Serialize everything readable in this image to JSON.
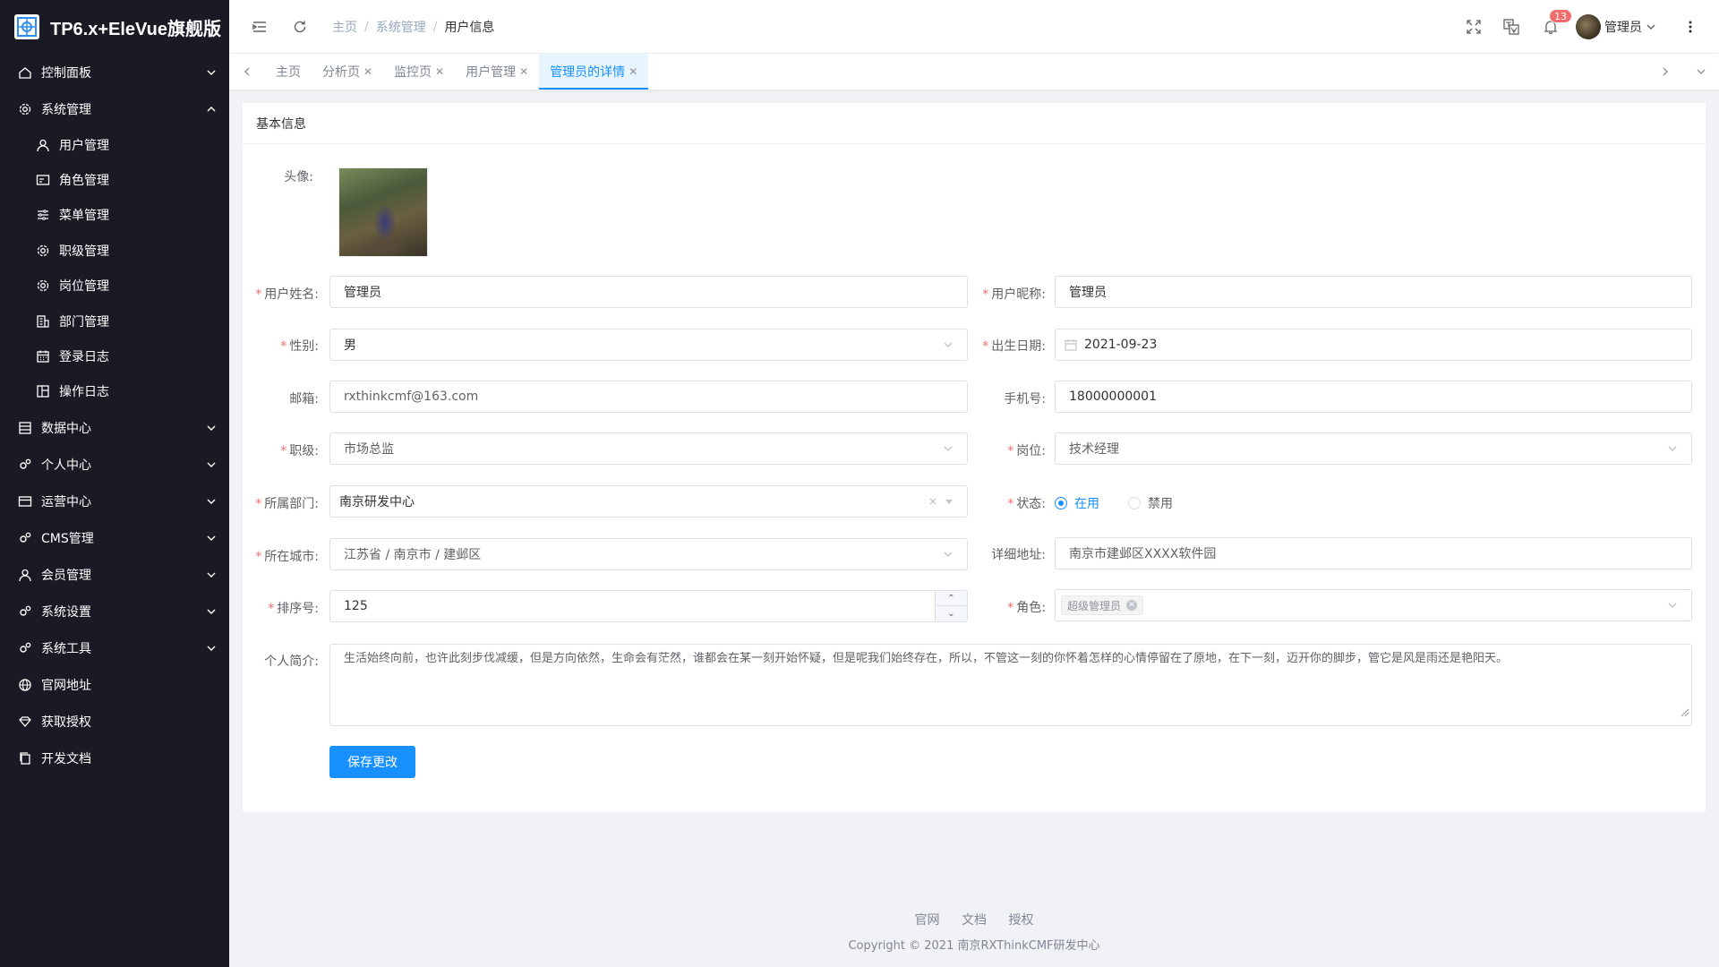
{
  "app": {
    "title": "TP6.x+EleVue旗舰版"
  },
  "sidebar": {
    "items": [
      {
        "label": "控制面板",
        "icon": "home-icon"
      },
      {
        "label": "系统管理",
        "icon": "gear-icon"
      },
      {
        "label": "数据中心",
        "icon": "database-icon"
      },
      {
        "label": "个人中心",
        "icon": "gears-icon"
      },
      {
        "label": "运营中心",
        "icon": "card-icon"
      },
      {
        "label": "CMS管理",
        "icon": "gears-icon"
      },
      {
        "label": "会员管理",
        "icon": "user-icon"
      },
      {
        "label": "系统设置",
        "icon": "gears-icon"
      },
      {
        "label": "系统工具",
        "icon": "gears-icon"
      },
      {
        "label": "官网地址",
        "icon": "globe-icon"
      },
      {
        "label": "获取授权",
        "icon": "diamond-icon"
      },
      {
        "label": "开发文档",
        "icon": "copy-icon"
      }
    ],
    "submenu": [
      {
        "label": "用户管理",
        "icon": "user-icon"
      },
      {
        "label": "角色管理",
        "icon": "idcard-icon"
      },
      {
        "label": "菜单管理",
        "icon": "sliders-icon"
      },
      {
        "label": "职级管理",
        "icon": "gear-icon"
      },
      {
        "label": "岗位管理",
        "icon": "gear-icon"
      },
      {
        "label": "部门管理",
        "icon": "building-icon"
      },
      {
        "label": "登录日志",
        "icon": "calendar-icon"
      },
      {
        "label": "操作日志",
        "icon": "layout-icon"
      }
    ]
  },
  "header": {
    "breadcrumb": [
      "主页",
      "系统管理",
      "用户信息"
    ],
    "notification_count": "13",
    "username": "管理员"
  },
  "tabs": [
    {
      "label": "主页",
      "closable": false
    },
    {
      "label": "分析页",
      "closable": true
    },
    {
      "label": "监控页",
      "closable": true
    },
    {
      "label": "用户管理",
      "closable": true
    },
    {
      "label": "管理员的详情",
      "closable": true,
      "active": true
    }
  ],
  "card": {
    "title": "基本信息"
  },
  "form": {
    "avatar_label": "头像:",
    "realname": {
      "label": "用户姓名:",
      "value": "管理员",
      "required": true
    },
    "nickname": {
      "label": "用户昵称:",
      "value": "管理员",
      "required": true
    },
    "gender": {
      "label": "性别:",
      "value": "男",
      "required": true
    },
    "birthday": {
      "label": "出生日期:",
      "value": "2021-09-23",
      "required": true
    },
    "email": {
      "label": "邮箱:",
      "value": "rxthinkcmf@163.com"
    },
    "mobile": {
      "label": "手机号:",
      "value": "18000000001"
    },
    "level": {
      "label": "职级:",
      "value": "市场总监",
      "required": true
    },
    "position": {
      "label": "岗位:",
      "value": "技术经理",
      "required": true
    },
    "dept": {
      "label": "所属部门:",
      "value": "南京研发中心",
      "required": true
    },
    "status": {
      "label": "状态:",
      "options": [
        "在用",
        "禁用"
      ],
      "selected": "在用",
      "required": true
    },
    "city": {
      "label": "所在城市:",
      "value": "江苏省 / 南京市 / 建邺区",
      "required": true
    },
    "address": {
      "label": "详细地址:",
      "value": "南京市建邺区XXXX软件园"
    },
    "sort": {
      "label": "排序号:",
      "value": "125",
      "required": true
    },
    "role": {
      "label": "角色:",
      "tags": [
        "超级管理员"
      ],
      "required": true
    },
    "intro": {
      "label": "个人简介:",
      "value": "生活始终向前，也许此刻步伐减缓，但是方向依然，生命会有茫然，谁都会在某一刻开始怀疑，但是呢我们始终存在，所以，不管这一刻的你怀着怎样的心情停留在了原地，在下一刻，迈开你的脚步，管它是风是雨还是艳阳天。"
    },
    "submit": "保存更改"
  },
  "footer": {
    "links": [
      "官网",
      "文档",
      "授权"
    ],
    "copyright": "Copyright © 2021 南京RXThinkCMF研发中心"
  },
  "colors": {
    "primary": "#1890ff",
    "sidebar_bg": "#191a23",
    "danger": "#f56c6c"
  }
}
